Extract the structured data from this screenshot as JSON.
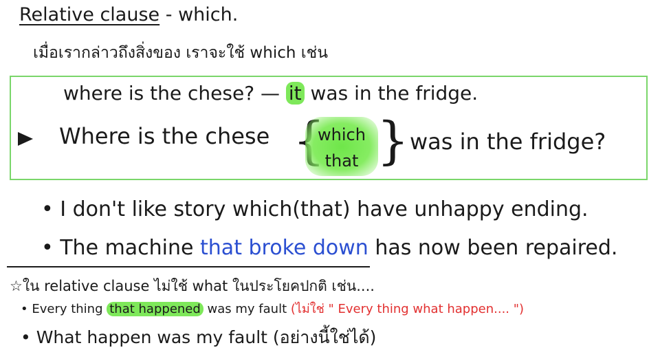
{
  "title": {
    "underlined": "Relative clause",
    "rest": " - which."
  },
  "intro": "เมื่อเรากล่าวถึงสิ่งของ เราจะใช้ which เช่น",
  "box": {
    "line1_before": "where is the chese? — ",
    "line1_hl": "it",
    "line1_after": " was in the fridge.",
    "line2_before": "Where is the chese",
    "alt_1": "which",
    "alt_2": "that",
    "line2_after": "was in the fridge?"
  },
  "bullets": {
    "b1": "• I don't like story which(that) have unhappy ending.",
    "b2_before": "• The machine ",
    "b2_blue": "that broke down",
    "b2_after": " has now been repaired."
  },
  "note": "☆ใน relative clause ไม่ใช้ what ในประโยคปกติ เช่น....",
  "sub1": {
    "before": "• Every thing ",
    "hl": "that happened",
    "middle": " was my fault ",
    "red": "(ไม่ใช่ \" Every thing what happen.... \")"
  },
  "sub2": "• What happen was my fault (อย่างนี้ใช่ได้)",
  "colors": {
    "box_border": "#7ad66a",
    "highlight": "#7ee85a",
    "blue_text": "#2b4fd1",
    "red_text": "#e23030"
  }
}
